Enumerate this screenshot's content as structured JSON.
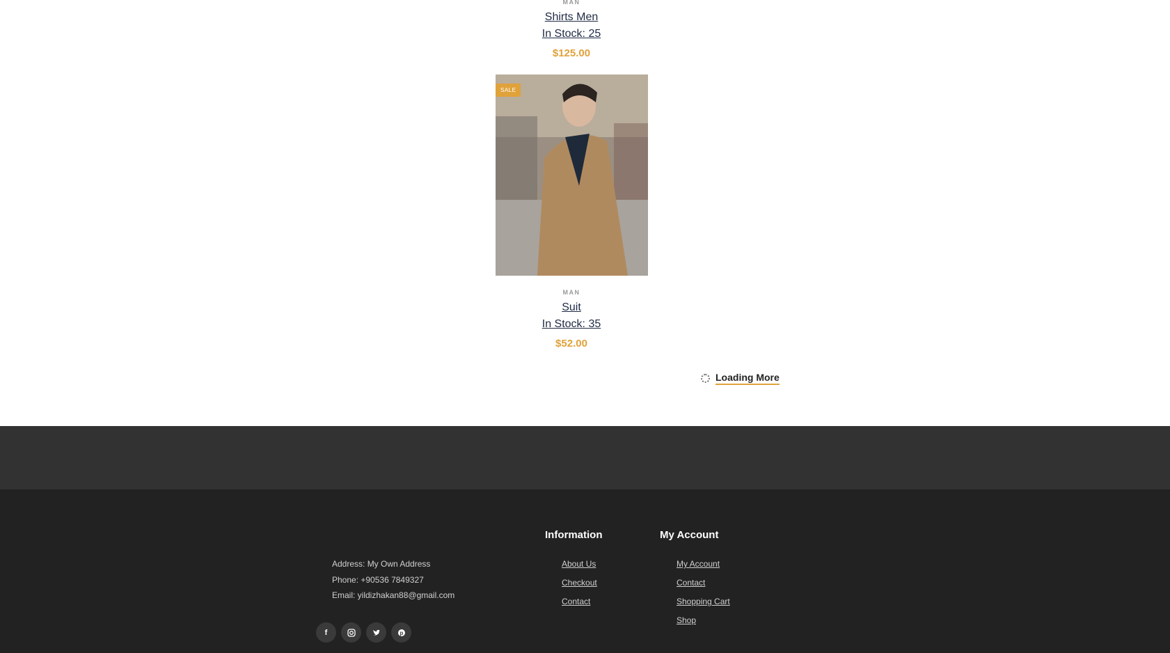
{
  "products": [
    {
      "category": "MAN",
      "name": "Shirts Men",
      "stock": "In Stock: 25",
      "price": "$125.00"
    },
    {
      "category": "MAN",
      "name": "Suit",
      "stock": "In Stock: 35",
      "price": "$52.00",
      "badge": "SALE"
    }
  ],
  "loading_more": "Loading More",
  "footer": {
    "address": "Address: My Own Address",
    "phone": "Phone: +90536 7849327",
    "email": "Email: yildizhakan88@gmail.com",
    "information": {
      "title": "Information",
      "links": [
        "About Us",
        "Checkout",
        "Contact"
      ]
    },
    "my_account": {
      "title": "My Account",
      "links": [
        "My Account",
        "Contact",
        "Shopping Cart",
        "Shop"
      ]
    },
    "social": [
      "facebook-icon",
      "instagram-icon",
      "twitter-icon",
      "pinterest-icon"
    ]
  },
  "colors": {
    "accent": "#e0a23a",
    "footer_band": "#323232",
    "footer_bg": "#222222"
  }
}
